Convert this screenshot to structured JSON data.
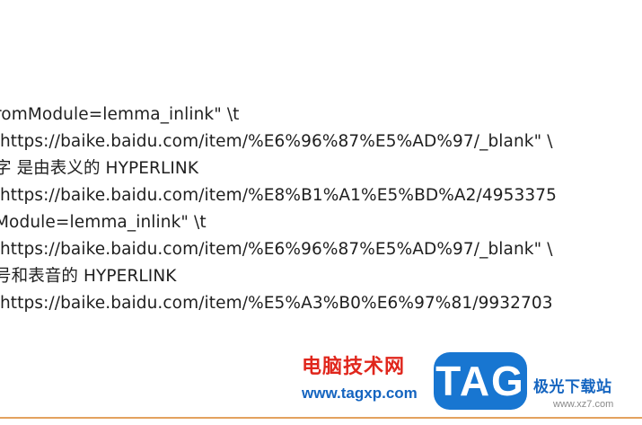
{
  "document": {
    "lines": [
      "romModule=lemma_inlink\" \\t",
      " https://baike.baidu.com/item/%E6%96%87%E5%AD%97/_blank\" \\",
      "字 是由表义的 HYPERLINK",
      " https://baike.baidu.com/item/%E8%B1%A1%E5%BD%A2/4953375",
      "Module=lemma_inlink\" \\t",
      " https://baike.baidu.com/item/%E6%96%87%E5%AD%97/_blank\" \\",
      "号和表音的 HYPERLINK",
      " https://baike.baidu.com/item/%E5%A3%B0%E6%97%81/9932703"
    ]
  },
  "watermark": {
    "site_name": "电脑技术网",
    "site_url": "www.tagxp.com",
    "tag_badge": "TAG",
    "right_name": "极光下载站",
    "right_url": "www.xz7.com"
  },
  "colors": {
    "text": "#1f1f1f",
    "watermark_red": "#e0261c",
    "watermark_blue": "#1565c0",
    "tag_blue": "#1876d1",
    "rule": "#e3a25f"
  }
}
